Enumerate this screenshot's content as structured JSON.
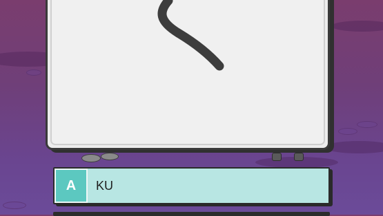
{
  "card": {
    "character": "く",
    "stroke_color": "#3d3d3d"
  },
  "options": [
    {
      "letter": "A",
      "answer": "KU"
    }
  ],
  "colors": {
    "option_background": "#b8e6e3",
    "option_letter_background": "#5cc8c0"
  }
}
